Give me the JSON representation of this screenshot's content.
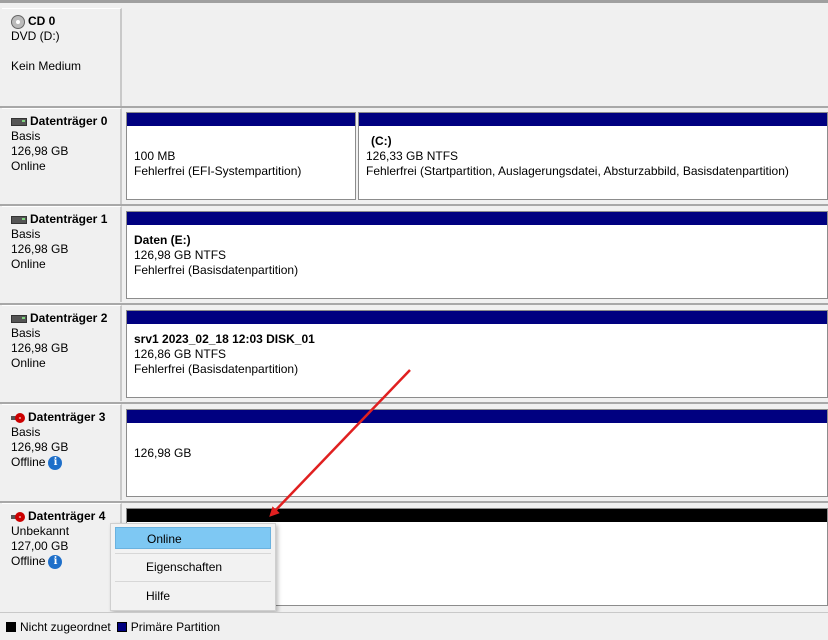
{
  "disks": [
    {
      "name": "CD 0",
      "line1": "DVD (D:)",
      "line2": "",
      "line3": "Kein Medium",
      "icon": "cd-icon"
    },
    {
      "name": "Datenträger 0",
      "line1": "Basis",
      "line2": "126,98 GB",
      "line3": "Online",
      "icon": "disk-icon"
    },
    {
      "name": "Datenträger 1",
      "line1": "Basis",
      "line2": "126,98 GB",
      "line3": "Online",
      "icon": "disk-icon"
    },
    {
      "name": "Datenträger 2",
      "line1": "Basis",
      "line2": "126,98 GB",
      "line3": "Online",
      "icon": "disk-icon"
    },
    {
      "name": "Datenträger 3",
      "line1": "Basis",
      "line2": "126,98 GB",
      "line3": "Offline",
      "icon": "disk-offline-icon"
    },
    {
      "name": "Datenträger 4",
      "line1": "Unbekannt",
      "line2": "127,00 GB",
      "line3": "Offline",
      "icon": "disk-offline-icon"
    }
  ],
  "partitions": {
    "d0_efi": {
      "size": "100 MB",
      "status": "Fehlerfrei (EFI-Systempartition)"
    },
    "d0_c": {
      "title": "(C:)",
      "size": "126,33 GB NTFS",
      "status": "Fehlerfrei (Startpartition, Auslagerungsdatei, Absturzabbild, Basisdatenpartition)"
    },
    "d1": {
      "title": "Daten  (E:)",
      "size": "126,98 GB NTFS",
      "status": "Fehlerfrei (Basisdatenpartition)"
    },
    "d2": {
      "title": "srv1 2023_02_18 12:03 DISK_01",
      "size": "126,86 GB NTFS",
      "status": "Fehlerfrei (Basisdatenpartition)"
    },
    "d3": {
      "size": "126,98 GB"
    }
  },
  "context_menu": {
    "items": [
      "Online",
      "Eigenschaften",
      "Hilfe"
    ]
  },
  "legend": {
    "unallocated": "Nicht zugeordnet",
    "primary": "Primäre Partition"
  },
  "colors": {
    "primary": "#000080",
    "unallocated": "#000000",
    "highlight": "#7ec8f3",
    "annotation_arrow": "#e02020"
  }
}
